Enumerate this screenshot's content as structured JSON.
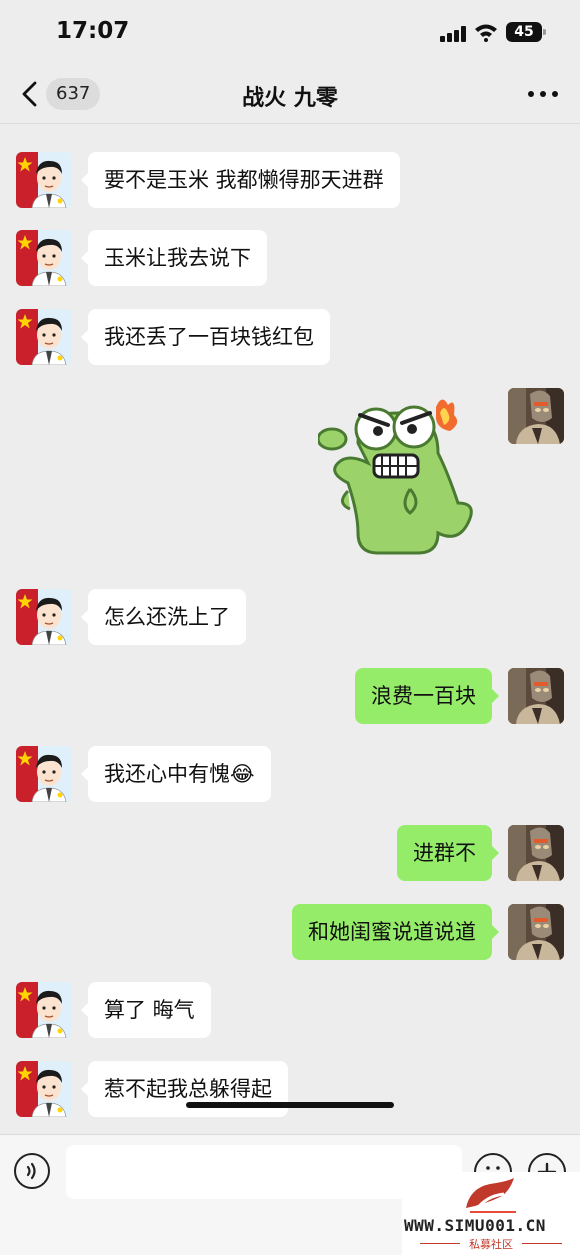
{
  "status_bar": {
    "time": "17:07",
    "battery": "45"
  },
  "nav": {
    "unread_count": "637",
    "title": "战火 九零"
  },
  "messages": [
    {
      "text": "要不是玉米 我都懒得那天进群"
    },
    {
      "text": "玉米让我去说下"
    },
    {
      "text": "我还丢了一百块钱红包"
    },
    {
      "text": "怎么还洗上了"
    },
    {
      "text": "浪费一百块"
    },
    {
      "text": "我还心中有愧😂"
    },
    {
      "text": "进群不"
    },
    {
      "text": "和她闺蜜说道说道"
    },
    {
      "text": "算了 晦气"
    },
    {
      "text": "惹不起我总躲得起"
    }
  ],
  "input": {
    "placeholder": ""
  },
  "watermark": {
    "site": "WWW.SIMU001.CN",
    "label": "私募社区"
  },
  "colors": {
    "background": "#ededed",
    "sent_bubble": "#95ec69",
    "received_bubble": "#ffffff"
  }
}
